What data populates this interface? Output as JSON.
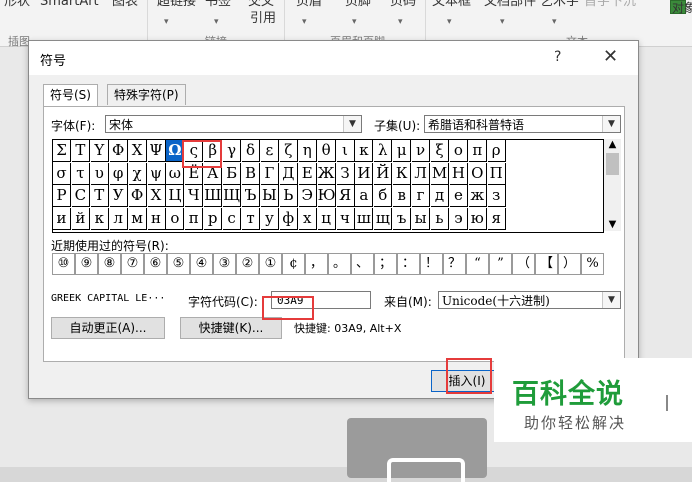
{
  "ribbon": {
    "items": [
      "形状",
      "SmartArt",
      "图表",
      "超链接",
      "书签",
      "交叉",
      "页眉",
      "页脚",
      "页码",
      "文本框",
      "文档部件",
      "艺术字",
      "首字下沉",
      "对象"
    ],
    "xref_line2": "引用",
    "groups": [
      "插图",
      "链接",
      "页眉和页脚",
      "文本"
    ]
  },
  "dialog": {
    "title": "符号",
    "help": "?",
    "close": "✕",
    "tabs": [
      "符号(S)",
      "特殊字符(P)"
    ],
    "font_label": "字体(F):",
    "font_value": "宋体",
    "subset_label": "子集(U):",
    "subset_value": "希腊语和科普特语",
    "symbols": [
      [
        "Σ",
        "Τ",
        "Υ",
        "Φ",
        "Χ",
        "Ψ",
        "Ω",
        "ς",
        "β",
        "γ",
        "δ",
        "ε",
        "ζ",
        "η",
        "θ",
        "ι",
        "κ",
        "λ",
        "μ",
        "ν",
        "ξ",
        "ο",
        "π",
        "ρ"
      ],
      [
        "σ",
        "τ",
        "υ",
        "φ",
        "χ",
        "ψ",
        "ω",
        "Ё",
        "А",
        "Б",
        "В",
        "Г",
        "Д",
        "Е",
        "Ж",
        "З",
        "И",
        "Й",
        "К",
        "Л",
        "М",
        "Н",
        "О",
        "П"
      ],
      [
        "Р",
        "С",
        "Т",
        "У",
        "Ф",
        "Х",
        "Ц",
        "Ч",
        "Ш",
        "Щ",
        "Ъ",
        "Ы",
        "Ь",
        "Э",
        "Ю",
        "Я",
        "а",
        "б",
        "в",
        "г",
        "д",
        "е",
        "ж",
        "з"
      ],
      [
        "и",
        "й",
        "к",
        "л",
        "м",
        "н",
        "о",
        "п",
        "р",
        "с",
        "т",
        "у",
        "ф",
        "х",
        "ц",
        "ч",
        "ш",
        "щ",
        "ъ",
        "ы",
        "ь",
        "э",
        "ю",
        "я"
      ]
    ],
    "selected_symbol": "Ω",
    "recent_label": "近期使用过的符号(R):",
    "recent": [
      "⑩",
      "⑨",
      "⑧",
      "⑦",
      "⑥",
      "⑤",
      "④",
      "③",
      "②",
      "①",
      "¢",
      "，",
      "。",
      "、",
      "；",
      "：",
      "！",
      "？",
      "“",
      "”",
      "（",
      "【",
      "）",
      "%"
    ],
    "char_name": "GREEK CAPITAL LE···",
    "code_label": "字符代码(C):",
    "code_value": "03A9",
    "from_label": "来自(M):",
    "from_value": "Unicode(十六进制)",
    "autocorrect_btn": "自动更正(A)...",
    "shortcut_btn": "快捷键(K)...",
    "shortcut_text": "快捷键: 03A9, Alt+X",
    "insert_btn": "插入(I)"
  },
  "watermark": {
    "title": "百科全说",
    "subtitle": "助你轻松解决"
  }
}
